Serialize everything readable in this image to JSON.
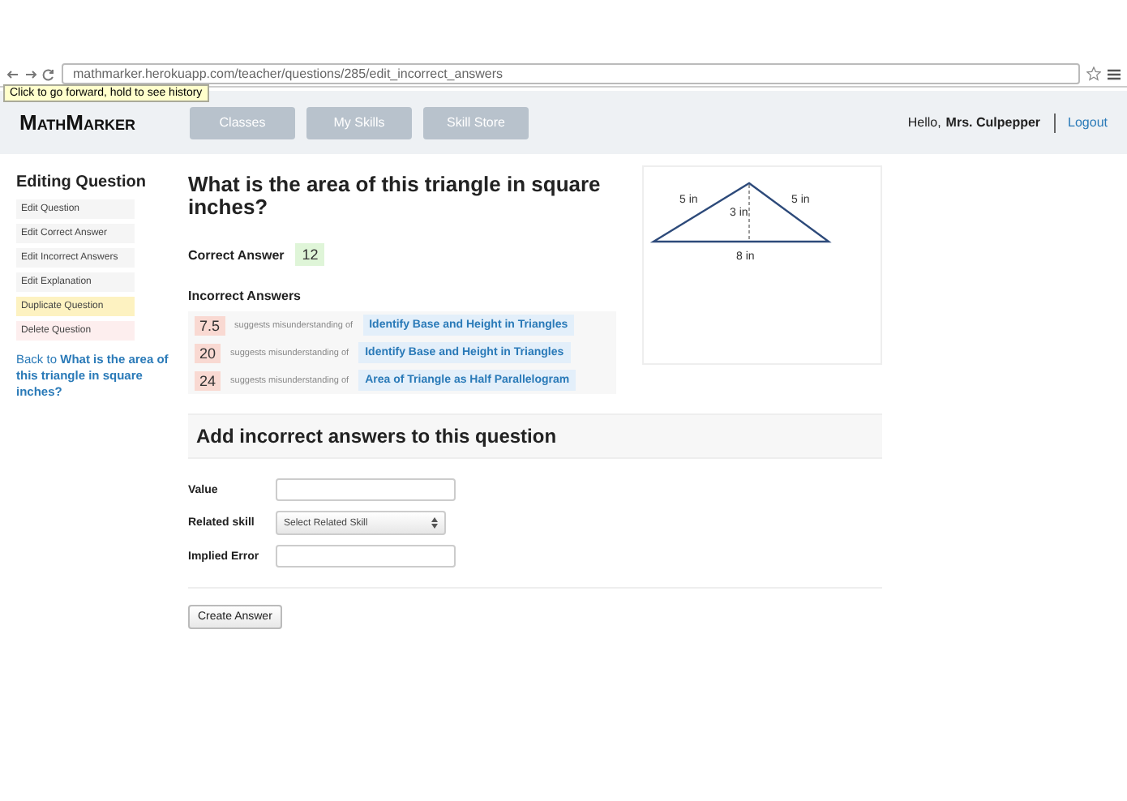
{
  "browser": {
    "url": "mathmarker.herokuapp.com/teacher/questions/285/edit_incorrect_answers",
    "tooltip": "Click to go forward, hold to see history"
  },
  "nav": {
    "logo": "MathMarker",
    "tabs": [
      {
        "label": "Classes"
      },
      {
        "label": "My Skills"
      },
      {
        "label": "Skill Store"
      }
    ],
    "greeting": "Hello,",
    "user": "Mrs. Culpepper",
    "logout": "Logout"
  },
  "sidebar": {
    "title": "Editing Question",
    "items": [
      {
        "label": "Edit Question",
        "kind": "normal"
      },
      {
        "label": "Edit Correct Answer",
        "kind": "normal"
      },
      {
        "label": "Edit Incorrect Answers",
        "kind": "normal"
      },
      {
        "label": "Edit Explanation",
        "kind": "normal"
      },
      {
        "label": "Duplicate Question",
        "kind": "duplicate"
      },
      {
        "label": "Delete Question",
        "kind": "delete"
      }
    ],
    "back_prefix": "Back to",
    "back_link": "What is the area of this triangle in square inches?"
  },
  "question": {
    "title": "What is the area of this triangle in square inches?",
    "correct_label": "Correct Answer",
    "correct_value": "12",
    "incorrect_label": "Incorrect Answers",
    "incorrect": [
      {
        "value": "7.5",
        "text": "suggests misunderstanding of",
        "skill": "Identify Base and Height in Triangles"
      },
      {
        "value": "20",
        "text": "suggests misunderstanding of",
        "skill": "Identify Base and Height in Triangles"
      },
      {
        "value": "24",
        "text": "suggests misunderstanding of",
        "skill": "Area of Triangle as Half Parallelogram"
      }
    ],
    "figure": {
      "left_side": "5 in",
      "right_side": "5 in",
      "height": "3 in",
      "base": "8 in"
    }
  },
  "form": {
    "title": "Add incorrect answers to this question",
    "fields": [
      {
        "label": "Value",
        "kind": "text"
      },
      {
        "label": "Related skill",
        "kind": "select",
        "value": "Select Related Skill"
      },
      {
        "label": "Implied Error",
        "kind": "text"
      }
    ],
    "submit": "Create Answer"
  }
}
